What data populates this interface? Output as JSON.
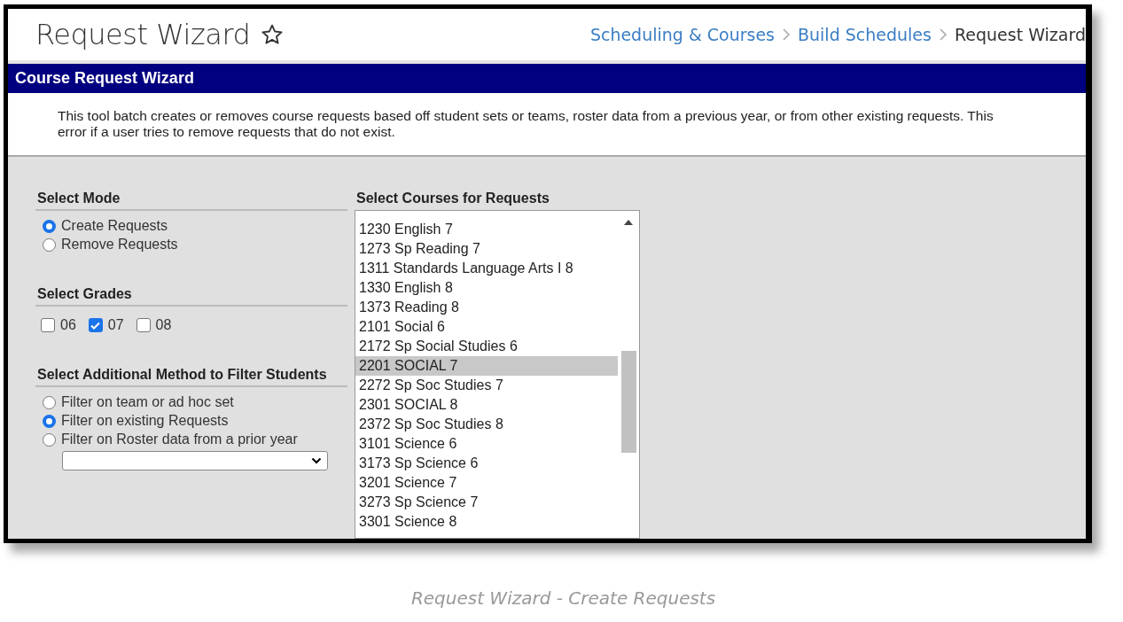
{
  "header": {
    "title": "Request Wizard",
    "breadcrumbs": [
      {
        "label": "Scheduling & Courses",
        "current": false
      },
      {
        "label": "Build Schedules",
        "current": false
      },
      {
        "label": "Request Wizard",
        "current": true
      }
    ]
  },
  "panel": {
    "title": "Course Request Wizard",
    "description_lines": [
      "This tool batch creates or removes course requests based off student sets or teams, roster data from a previous year, or from other existing requests. This",
      "error if a user tries to remove requests that do not exist."
    ]
  },
  "select_mode": {
    "heading": "Select Mode",
    "options": [
      {
        "label": "Create Requests",
        "selected": true
      },
      {
        "label": "Remove Requests",
        "selected": false
      }
    ]
  },
  "select_grades": {
    "heading": "Select Grades",
    "grades": [
      {
        "label": "06",
        "checked": false
      },
      {
        "label": "07",
        "checked": true
      },
      {
        "label": "08",
        "checked": false
      }
    ]
  },
  "filter_method": {
    "heading": "Select Additional Method to Filter Students",
    "options": [
      {
        "label": "Filter on team or ad hoc set",
        "selected": false
      },
      {
        "label": "Filter on existing Requests",
        "selected": true
      },
      {
        "label": "Filter on Roster data from a prior year",
        "selected": false
      }
    ]
  },
  "courses": {
    "heading": "Select Courses for Requests",
    "items": [
      {
        "label": "1230 English 7",
        "selected": false
      },
      {
        "label": "1273 Sp Reading 7",
        "selected": false
      },
      {
        "label": "1311 Standards Language Arts I 8",
        "selected": false
      },
      {
        "label": "1330 English 8",
        "selected": false
      },
      {
        "label": "1373 Reading 8",
        "selected": false
      },
      {
        "label": "2101 Social 6",
        "selected": false
      },
      {
        "label": "2172 Sp Social Studies 6",
        "selected": false
      },
      {
        "label": "2201 SOCIAL 7",
        "selected": true
      },
      {
        "label": "2272 Sp Soc Studies 7",
        "selected": false
      },
      {
        "label": "2301 SOCIAL 8",
        "selected": false
      },
      {
        "label": "2372 Sp Soc Studies 8",
        "selected": false
      },
      {
        "label": "3101 Science 6",
        "selected": false
      },
      {
        "label": "3173 Sp Science 6",
        "selected": false
      },
      {
        "label": "3201 Science 7",
        "selected": false
      },
      {
        "label": "3273 Sp Science 7",
        "selected": false
      },
      {
        "label": "3301 Science 8",
        "selected": false
      }
    ]
  },
  "caption": "Request Wizard - Create Requests"
}
